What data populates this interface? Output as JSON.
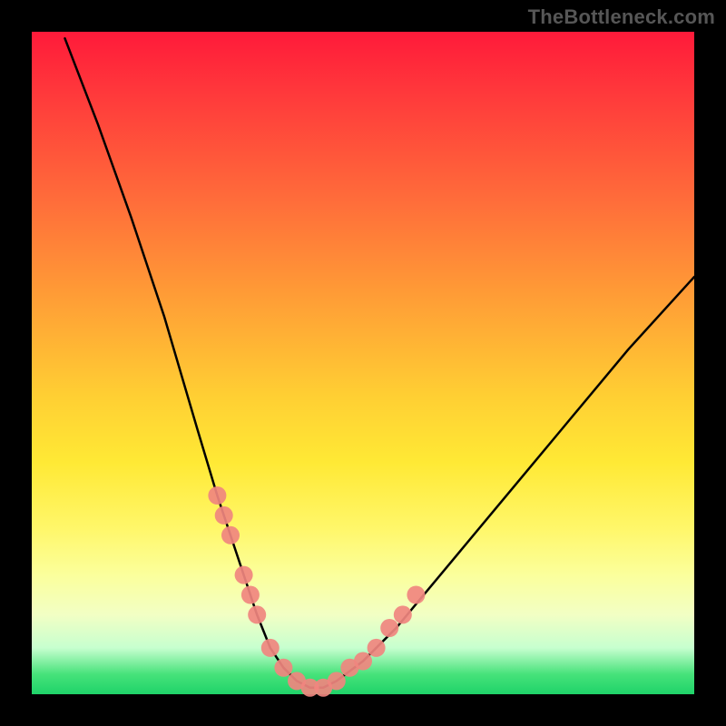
{
  "attribution": "TheBottleneck.com",
  "chart_data": {
    "type": "line",
    "title": "",
    "xlabel": "",
    "ylabel": "",
    "xlim": [
      0,
      100
    ],
    "ylim": [
      0,
      100
    ],
    "series": [
      {
        "name": "bottleneck-curve",
        "x": [
          5,
          10,
          15,
          20,
          25,
          28,
          30,
          32,
          34,
          36,
          38,
          40,
          42,
          44,
          46,
          50,
          55,
          60,
          70,
          80,
          90,
          100
        ],
        "values": [
          99,
          86,
          72,
          57,
          40,
          30,
          24,
          18,
          12,
          7,
          4,
          2,
          1,
          1,
          2,
          5,
          10,
          16,
          28,
          40,
          52,
          63
        ]
      }
    ],
    "markers": {
      "name": "sample-points",
      "color": "#f0867f",
      "x": [
        28,
        29,
        30,
        32,
        33,
        34,
        36,
        38,
        40,
        42,
        44,
        46,
        48,
        50,
        52,
        54,
        56,
        58
      ],
      "values": [
        30,
        27,
        24,
        18,
        15,
        12,
        7,
        4,
        2,
        1,
        1,
        2,
        4,
        5,
        7,
        10,
        12,
        15
      ]
    },
    "background_gradient": {
      "top": "#ff1a3a",
      "mid": "#ffe935",
      "bottom": "#1fd369"
    }
  }
}
